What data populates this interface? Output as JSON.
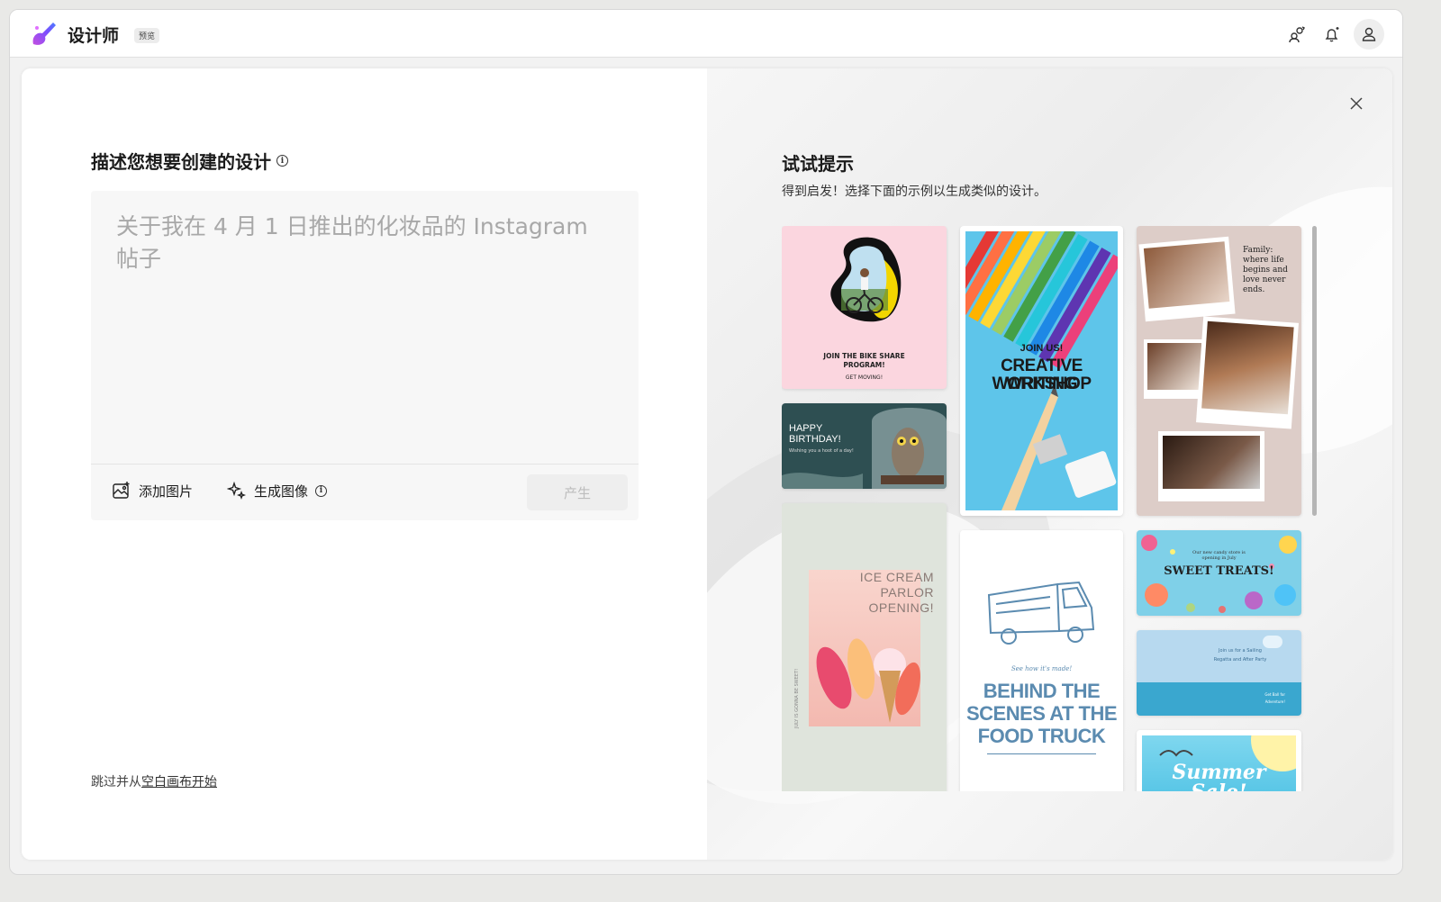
{
  "app": {
    "title": "设计师",
    "badge": "预览"
  },
  "titlebar": {
    "icons": [
      "people-switch-icon",
      "bell-sparkle-icon",
      "user-avatar-icon"
    ]
  },
  "compose": {
    "heading": "描述您想要创建的设计",
    "placeholder": "关于我在 4 月 1 日推出的化妆品的 Instagram 帖子",
    "add_image_label": "添加图片",
    "generate_image_label": "生成图像",
    "generate_button_label": "产生",
    "skip_prefix": "跳过并从",
    "skip_link": "空白画布开始"
  },
  "tips": {
    "title": "试试提示",
    "subtitle": "得到启发！选择下面的示例以生成类似的设计。",
    "cards": {
      "bike": {
        "line1": "JOIN THE BIKE SHARE",
        "line2": "PROGRAM!",
        "line3": "GET MOVING!"
      },
      "writing": {
        "line1": "JOIN US!",
        "line2": "CREATIVE WRITING",
        "line3": "WORKSHOP"
      },
      "family": {
        "text": "Family: where life begins and love never ends."
      },
      "birthday": {
        "line1": "HAPPY",
        "line2": "BIRTHDAY!",
        "line3": "Wishing you a hoot of a day!"
      },
      "icecream": {
        "line1": "ICE CREAM",
        "line2": "PARLOR",
        "line3": "OPENING!",
        "side": "JULY IS GONNA BE SWEET!"
      },
      "foodtruck": {
        "small": "See how it's made!",
        "line1": "BEHIND THE",
        "line2": "SCENES AT THE",
        "line3": "FOOD TRUCK"
      },
      "treats": {
        "small1": "Our new candy store is",
        "small2": "opening in July",
        "big": "SWEET TREATS!"
      },
      "party": {
        "line1": "Join us for a Sailing",
        "line2": "Regatta and After Party",
        "line3": "Get Ball for",
        "line4": "Adventure!"
      },
      "summer": {
        "text": "Summer",
        "text2": "Sale!"
      }
    }
  },
  "colors": {
    "accent": "#7b4dff",
    "panel_bg": "#ffffff",
    "prompt_bg": "#f7f7f7"
  }
}
